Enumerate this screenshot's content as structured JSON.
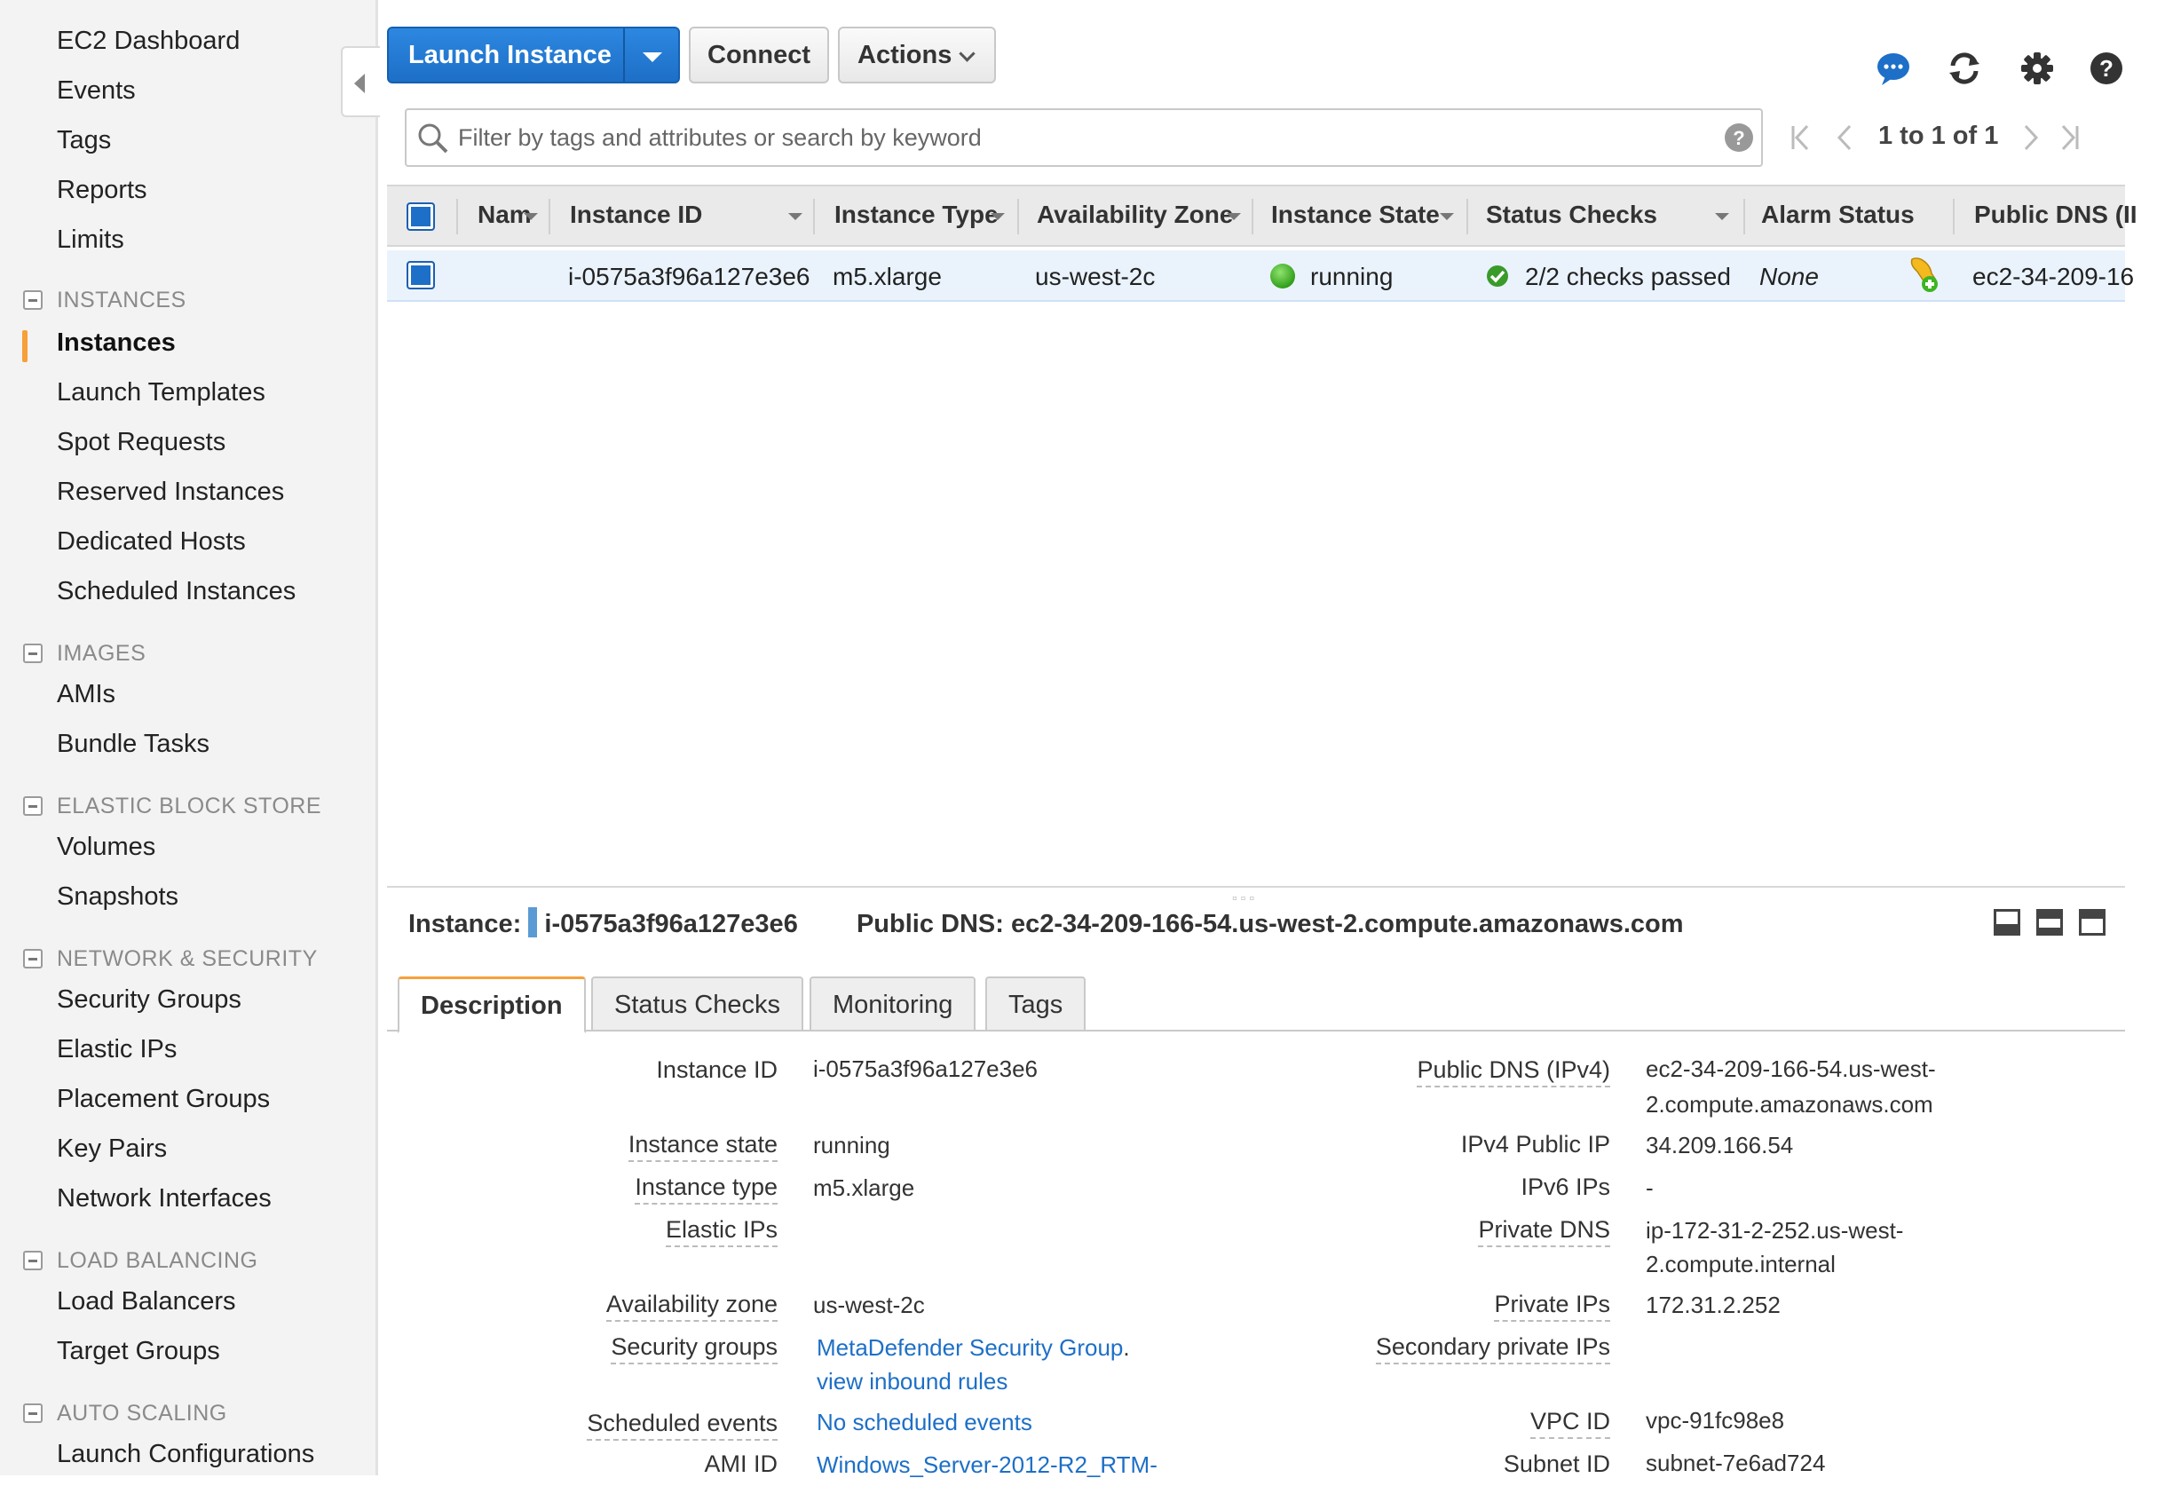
{
  "sidebar": {
    "top_items": [
      "EC2 Dashboard",
      "Events",
      "Tags",
      "Reports",
      "Limits"
    ],
    "sections": [
      {
        "title": "INSTANCES",
        "items": [
          "Instances",
          "Launch Templates",
          "Spot Requests",
          "Reserved Instances",
          "Dedicated Hosts",
          "Scheduled Instances"
        ]
      },
      {
        "title": "IMAGES",
        "items": [
          "AMIs",
          "Bundle Tasks"
        ]
      },
      {
        "title": "ELASTIC BLOCK STORE",
        "items": [
          "Volumes",
          "Snapshots"
        ]
      },
      {
        "title": "NETWORK & SECURITY",
        "items": [
          "Security Groups",
          "Elastic IPs",
          "Placement Groups",
          "Key Pairs",
          "Network Interfaces"
        ]
      },
      {
        "title": "LOAD BALANCING",
        "items": [
          "Load Balancers",
          "Target Groups"
        ]
      },
      {
        "title": "AUTO SCALING",
        "items": [
          "Launch Configurations"
        ]
      }
    ],
    "active_item": "Instances"
  },
  "toolbar": {
    "launch_label": "Launch Instance",
    "connect_label": "Connect",
    "actions_label": "Actions",
    "icons": [
      "chat-icon",
      "refresh-icon",
      "gear-icon",
      "help-icon"
    ]
  },
  "search": {
    "placeholder": "Filter by tags and attributes or search by keyword",
    "pager": "1 to 1 of 1"
  },
  "table": {
    "columns": [
      "Nam",
      "Instance ID",
      "Instance Type",
      "Availability Zone",
      "Instance State",
      "Status Checks",
      "Alarm Status",
      "Public DNS (II"
    ],
    "rows": [
      {
        "name": "",
        "instance_id": "i-0575a3f96a127e3e6",
        "instance_type": "m5.xlarge",
        "availability_zone": "us-west-2c",
        "instance_state": "running",
        "status_checks": "2/2 checks passed",
        "alarm_status": "None",
        "public_dns": "ec2-34-209-16"
      }
    ]
  },
  "detail": {
    "instance_label": "Instance:",
    "instance_id": "i-0575a3f96a127e3e6",
    "dns_label": "Public DNS:",
    "dns_value": "ec2-34-209-166-54.us-west-2.compute.amazonaws.com",
    "tabs": [
      "Description",
      "Status Checks",
      "Monitoring",
      "Tags"
    ],
    "active_tab": "Description",
    "left_fields": {
      "instance_id": {
        "label": "Instance ID",
        "value": "i-0575a3f96a127e3e6"
      },
      "instance_state": {
        "label": "Instance state",
        "value": "running"
      },
      "instance_type": {
        "label": "Instance type",
        "value": "m5.xlarge"
      },
      "elastic_ips": {
        "label": "Elastic IPs",
        "value": ""
      },
      "availability_zone": {
        "label": "Availability zone",
        "value": "us-west-2c"
      },
      "security_groups": {
        "label": "Security groups",
        "value": "MetaDefender Security Group",
        "extra": "view inbound rules"
      },
      "scheduled_events": {
        "label": "Scheduled events",
        "value": "No scheduled events"
      },
      "ami_id": {
        "label": "AMI ID",
        "value": "Windows_Server-2012-R2_RTM-"
      }
    },
    "right_fields": {
      "public_dns": {
        "label": "Public DNS (IPv4)",
        "value_line1": "ec2-34-209-166-54.us-west-",
        "value_line2": "2.compute.amazonaws.com"
      },
      "ipv4_public_ip": {
        "label": "IPv4 Public IP",
        "value": "34.209.166.54"
      },
      "ipv6_ips": {
        "label": "IPv6 IPs",
        "value": "-"
      },
      "private_dns": {
        "label": "Private DNS",
        "value_line1": "ip-172-31-2-252.us-west-",
        "value_line2": "2.compute.internal"
      },
      "private_ips": {
        "label": "Private IPs",
        "value": "172.31.2.252"
      },
      "secondary_private_ips": {
        "label": "Secondary private IPs",
        "value": ""
      },
      "vpc_id": {
        "label": "VPC ID",
        "value": "vpc-91fc98e8"
      },
      "subnet_id": {
        "label": "Subnet ID",
        "value": "subnet-7e6ad724"
      }
    }
  },
  "colors": {
    "accent": "#1d6fc7",
    "active_marker": "#f7a03a",
    "running": "#3cb521"
  }
}
